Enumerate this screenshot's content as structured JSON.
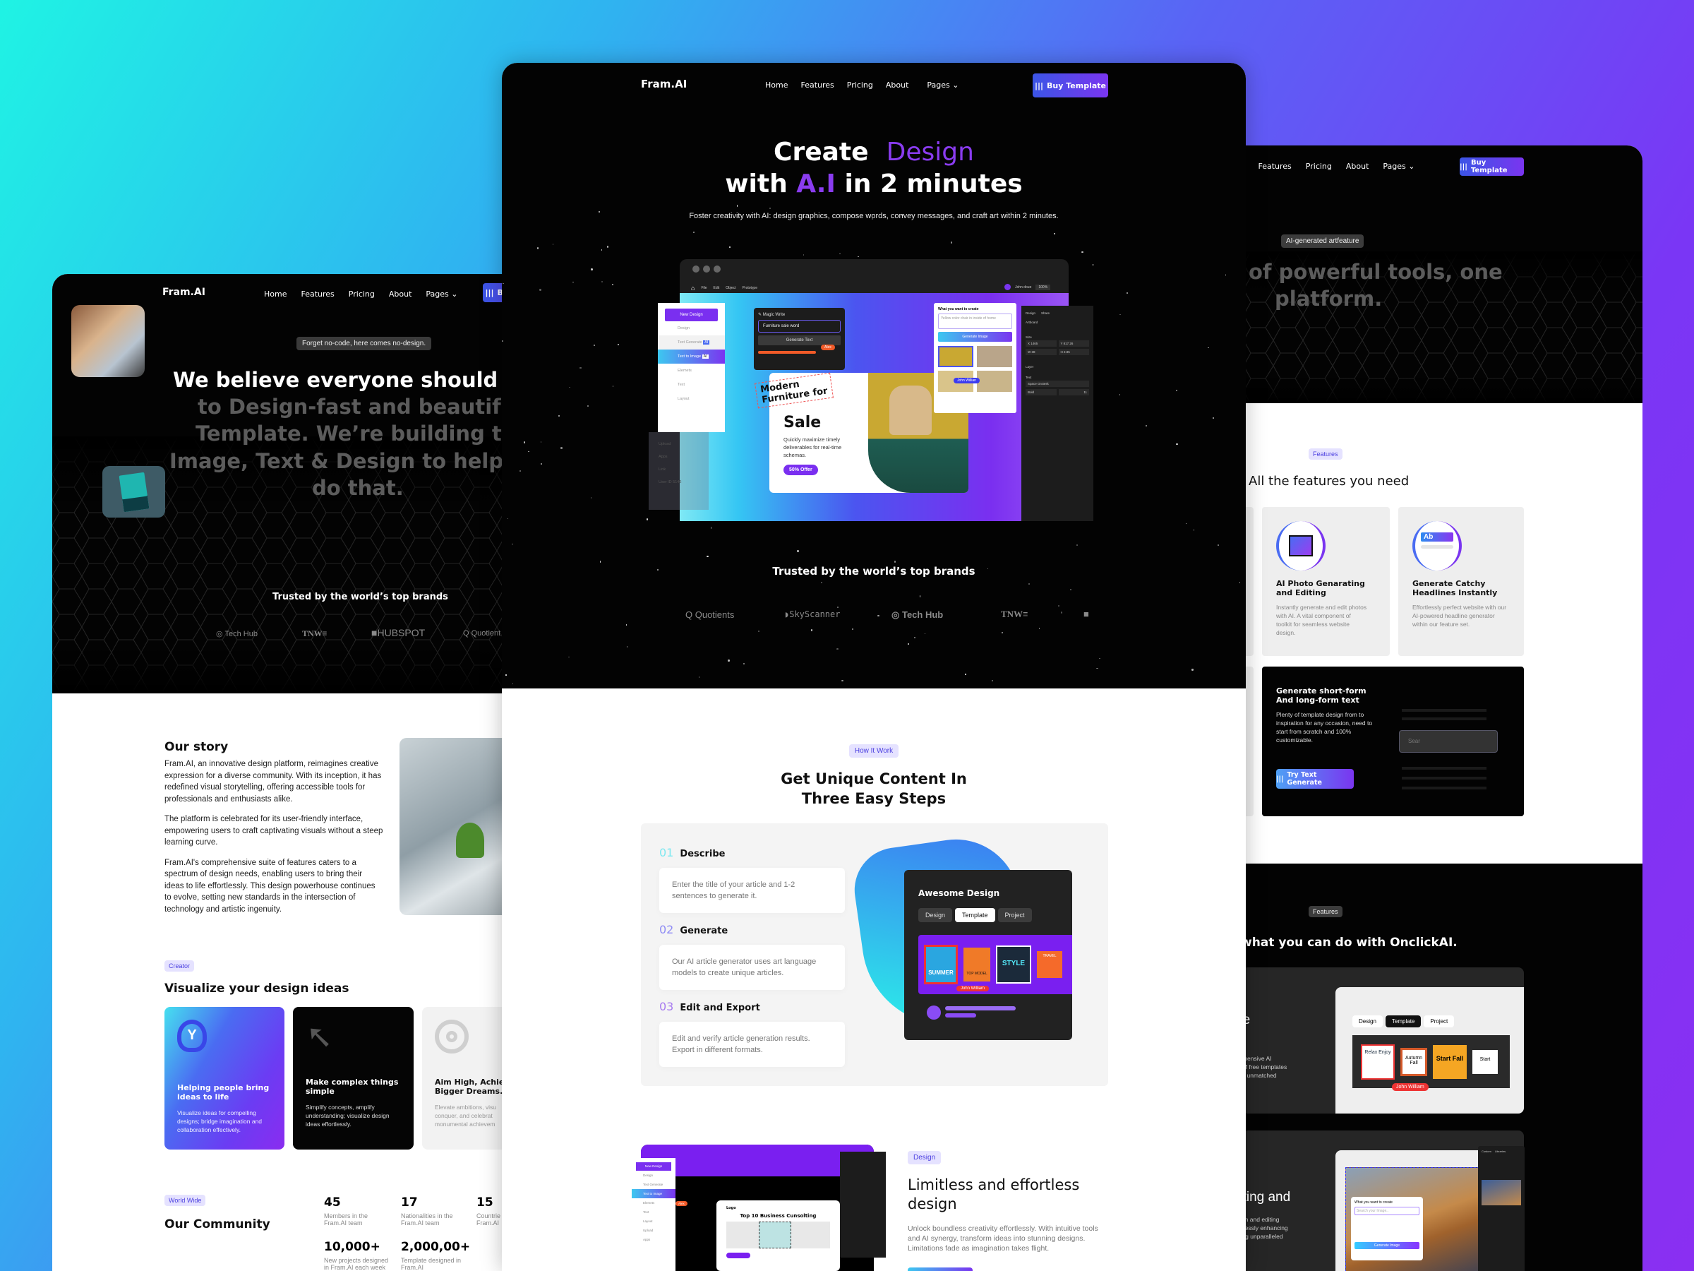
{
  "colors": {
    "accent": "#7b2ff7",
    "brand_blue": "#3b55e6",
    "dark": "#050505",
    "badge_bg": "#e5e2ff"
  },
  "nav": {
    "logo": "Fram.AI",
    "items": [
      "Home",
      "Features",
      "Pricing",
      "About",
      "Pages"
    ],
    "buy": "Buy Template",
    "buy_icon": "bars-icon"
  },
  "left": {
    "badge": "Forget no-code, here comes no-design.",
    "headline_lines": [
      "We believe everyone should ab",
      "to Design-fast and beautiful",
      "Template. We’re building the",
      "Image, Text & Design to help y",
      "do that."
    ],
    "trusted": "Trusted by the world’s top brands",
    "brands": [
      "Tech Hub",
      "TNW",
      "HUBSPOT",
      "Quotient"
    ],
    "story": {
      "title": "Our story",
      "paragraphs": [
        "Fram.AI, an innovative design platform, reimagines creative expression for a diverse community. With its inception, it has redefined visual storytelling, offering accessible tools for professionals and enthusiasts alike.",
        "The platform is celebrated for its user-friendly interface, empowering users to craft captivating visuals without a steep learning curve.",
        "Fram.AI's comprehensive suite of features caters to a spectrum of design needs, enabling users to bring their ideas to life effortlessly. This design powerhouse continues to evolve, setting new standards in the intersection of technology and artistic ingenuity."
      ]
    },
    "creator": {
      "badge": "Creator",
      "title": "Visualize your design ideas",
      "cards": [
        {
          "title": "Helping people bring ideas to life",
          "text": "Visualize ideas for compelling designs; bridge imagination and collaboration effectively.",
          "icon": "lightbulb-icon"
        },
        {
          "title": "Make complex things simple",
          "text": "Simplify concepts, amplify understanding; visualize design ideas effortlessly.",
          "icon": "cursor-icon"
        },
        {
          "title": "Aim High, Achiev Bigger Dreams.",
          "text": "Elevate ambitions, visu conquer, and celebrat monumental achievem",
          "icon": "target-icon"
        }
      ]
    },
    "community": {
      "badge": "World Wide",
      "title": "Our Community",
      "stats": [
        {
          "value": "45",
          "label": "Members in the Fram.AI team"
        },
        {
          "value": "17",
          "label": "Nationalities in the Fram.AI team"
        },
        {
          "value": "15",
          "label": "Countrie Fram.AI"
        },
        {
          "value": "10,000+",
          "label": "New projects designed in Fram.AI each week"
        },
        {
          "value": "2,000,00+",
          "label": "Template designed in Fram.AI"
        }
      ]
    }
  },
  "middle": {
    "title_1a": "Create",
    "title_1b": "Design",
    "title_2a": "with",
    "title_2b": "A.I",
    "title_2c": "in 2 minutes",
    "subtitle": "Foster creativity with AI: design graphics, compose words, convey messages, and craft art within 2 minutes.",
    "editor": {
      "menu": [
        "File",
        "Edit",
        "Object",
        "Prototype"
      ],
      "user": "John doue",
      "zoom": "100%",
      "sidebar": {
        "new": "New Design",
        "items": [
          "Design",
          "Text Generate",
          "Text to Image",
          "Elemets",
          "Text",
          "Layout"
        ],
        "ai_tag": "AI",
        "faded": [
          "Upload",
          "Apps",
          "Link",
          "User ID 5146"
        ]
      },
      "magic": {
        "title": "Magic Write",
        "input": "Furniture sale word",
        "button": "Generate Text",
        "cursor_user": "Alex"
      },
      "card": {
        "line1": "Modern",
        "line2": "Furniture for",
        "big": "Sale",
        "text": "Quickly maximize timely deliverables for real-time schemas.",
        "button": "50% Offer"
      },
      "create": {
        "title": "What you want to create",
        "input": "Yellow color chair in inside of home",
        "button": "Generate Image",
        "cursor_user": "John Willian"
      },
      "props": {
        "tabs": [
          "Design",
          "Share"
        ],
        "artboard": "Artboard",
        "size": "Size",
        "fields": [
          "X 1465",
          "Y 817.26",
          "W 38",
          "H 2.85"
        ],
        "layer": "Layer",
        "text": "Text",
        "font": "Space Grotesk",
        "weight": "Bold",
        "font_size": "11"
      }
    },
    "trusted": "Trusted by the world’s top brands",
    "brands": [
      "Quotients",
      "SkyScanner",
      "Tech Hub",
      "TNW"
    ],
    "how": {
      "badge": "How It Work",
      "title_1": "Get Unique Content In",
      "title_2": "Three Easy Steps",
      "steps": [
        {
          "num": "01",
          "title": "Describe",
          "text": "Enter the title of your article and  1-2 sentences to generate it."
        },
        {
          "num": "02",
          "title": "Generate",
          "text": "Our AI article generator uses art language models to create unique articles."
        },
        {
          "num": "03",
          "title": "Edit and Export",
          "text": "Edit and verify article generation results. Export in different formats."
        }
      ],
      "card": {
        "title": "Awesome Design",
        "tabs": [
          "Design",
          "Template",
          "Project"
        ],
        "active_tab": "Template",
        "thumbs": [
          "SUMMER",
          "TOP MODEL",
          "STYLE",
          "TRAVEL"
        ],
        "cursor_user": "John William"
      }
    },
    "design": {
      "badge": "Design",
      "title": "Limitless and effortless design",
      "text": "Unlock boundless creativity effortlessly. With intuitive tools and AI synergy, transform ideas into stunning designs. Limitations fade as imagination takes flight.",
      "mock": {
        "new": "New Design",
        "items": [
          "Design",
          "Text Generate",
          "Text to Image",
          "Elemets",
          "Text",
          "Layout",
          "Upload",
          "Apps"
        ],
        "cursor_user": "Alex",
        "logo": "Logo",
        "heading": "Top 10 Business Cunsolting"
      }
    }
  },
  "right": {
    "badge": "AI-generated artfeature",
    "headline_lines": [
      "of powerful tools, one",
      "platform."
    ],
    "features": {
      "badge": "Features",
      "title": "All the features you need",
      "cards": [
        {
          "title": "AI Photo Genarating and Editing",
          "text": "Instantly generate and edit photos with AI. A vital component of toolkit for seamless website design.",
          "icon": "photo-edit-icon"
        },
        {
          "title": "Generate Catchy Headlines Instantly",
          "text": "Effortlessly perfect website with our AI-powered headline generator within our feature set.",
          "icon": "headline-icon",
          "icon_text": "Ab"
        }
      ],
      "dark_card": {
        "title": "Generate short-form And long-form text",
        "text": "Plenty of template design from to inspiration for any occasion, need to start from scratch and 100% customizable.",
        "button": "Try Text Generate",
        "search": "Sear"
      }
    },
    "onclick": {
      "badge": "Features",
      "title": "what you can do with OnclickAI.",
      "card1": {
        "title": "ee",
        "text_lines": [
          "prehensive AI",
          "ra of free templates",
          "and unmatched"
        ],
        "tabs": [
          "Design",
          "Template",
          "Project"
        ],
        "active_tab": "Template",
        "thumbs": [
          "Relax Enjoy",
          "Autumn Fall",
          "Start Fall",
          "Start"
        ],
        "cursor_user": "John William"
      },
      "card2": {
        "title": "ating and",
        "text_lines": [
          "ation and editing",
          "amlessly enhancing",
          "uring unparalleled"
        ],
        "create": "What you want to create",
        "search": "Search your Image..",
        "button": "Generate Image",
        "tabs": [
          "Custom",
          "Libraries"
        ]
      }
    }
  }
}
